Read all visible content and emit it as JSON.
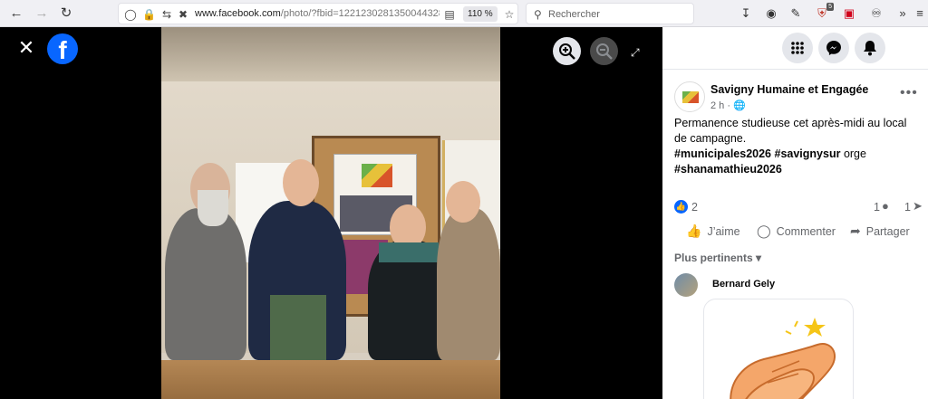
{
  "browser": {
    "back_icon": "arrow-left-icon",
    "forward_icon": "arrow-right-icon",
    "reload_icon": "reload-icon",
    "url_host": "www.facebook.com",
    "url_path": "/photo/?fbid=1221230281350044328",
    "zoom_level": "110 %",
    "search_placeholder": "Rechercher"
  },
  "viewer": {
    "close_icon": "close-icon",
    "logo": "f",
    "zoom_in_icon": "zoom-in-icon",
    "zoom_out_icon": "zoom-out-icon",
    "expand_icon": "expand-icon"
  },
  "panel": {
    "top_buttons": [
      "menu-grid-icon",
      "messenger-icon",
      "notifications-icon"
    ],
    "post": {
      "page_name": "Savigny Humaine et Engagée",
      "time": "2 h ·",
      "more_label": "•••",
      "text_line1": "Permanence studieuse cet après-midi au local de campagne.",
      "tag1": "#municipales2026",
      "tag2": "#savignysur",
      "tag2_rest": " orge",
      "tag3": "#shanamathieu2026",
      "like_count": "2",
      "comment_count": "1",
      "share_count": "1"
    },
    "actions": {
      "like": "J’aime",
      "comment": "Commenter",
      "share": "Partager"
    },
    "filter_label": "Plus pertinents",
    "comment": {
      "author": "Bernard Gely"
    }
  }
}
